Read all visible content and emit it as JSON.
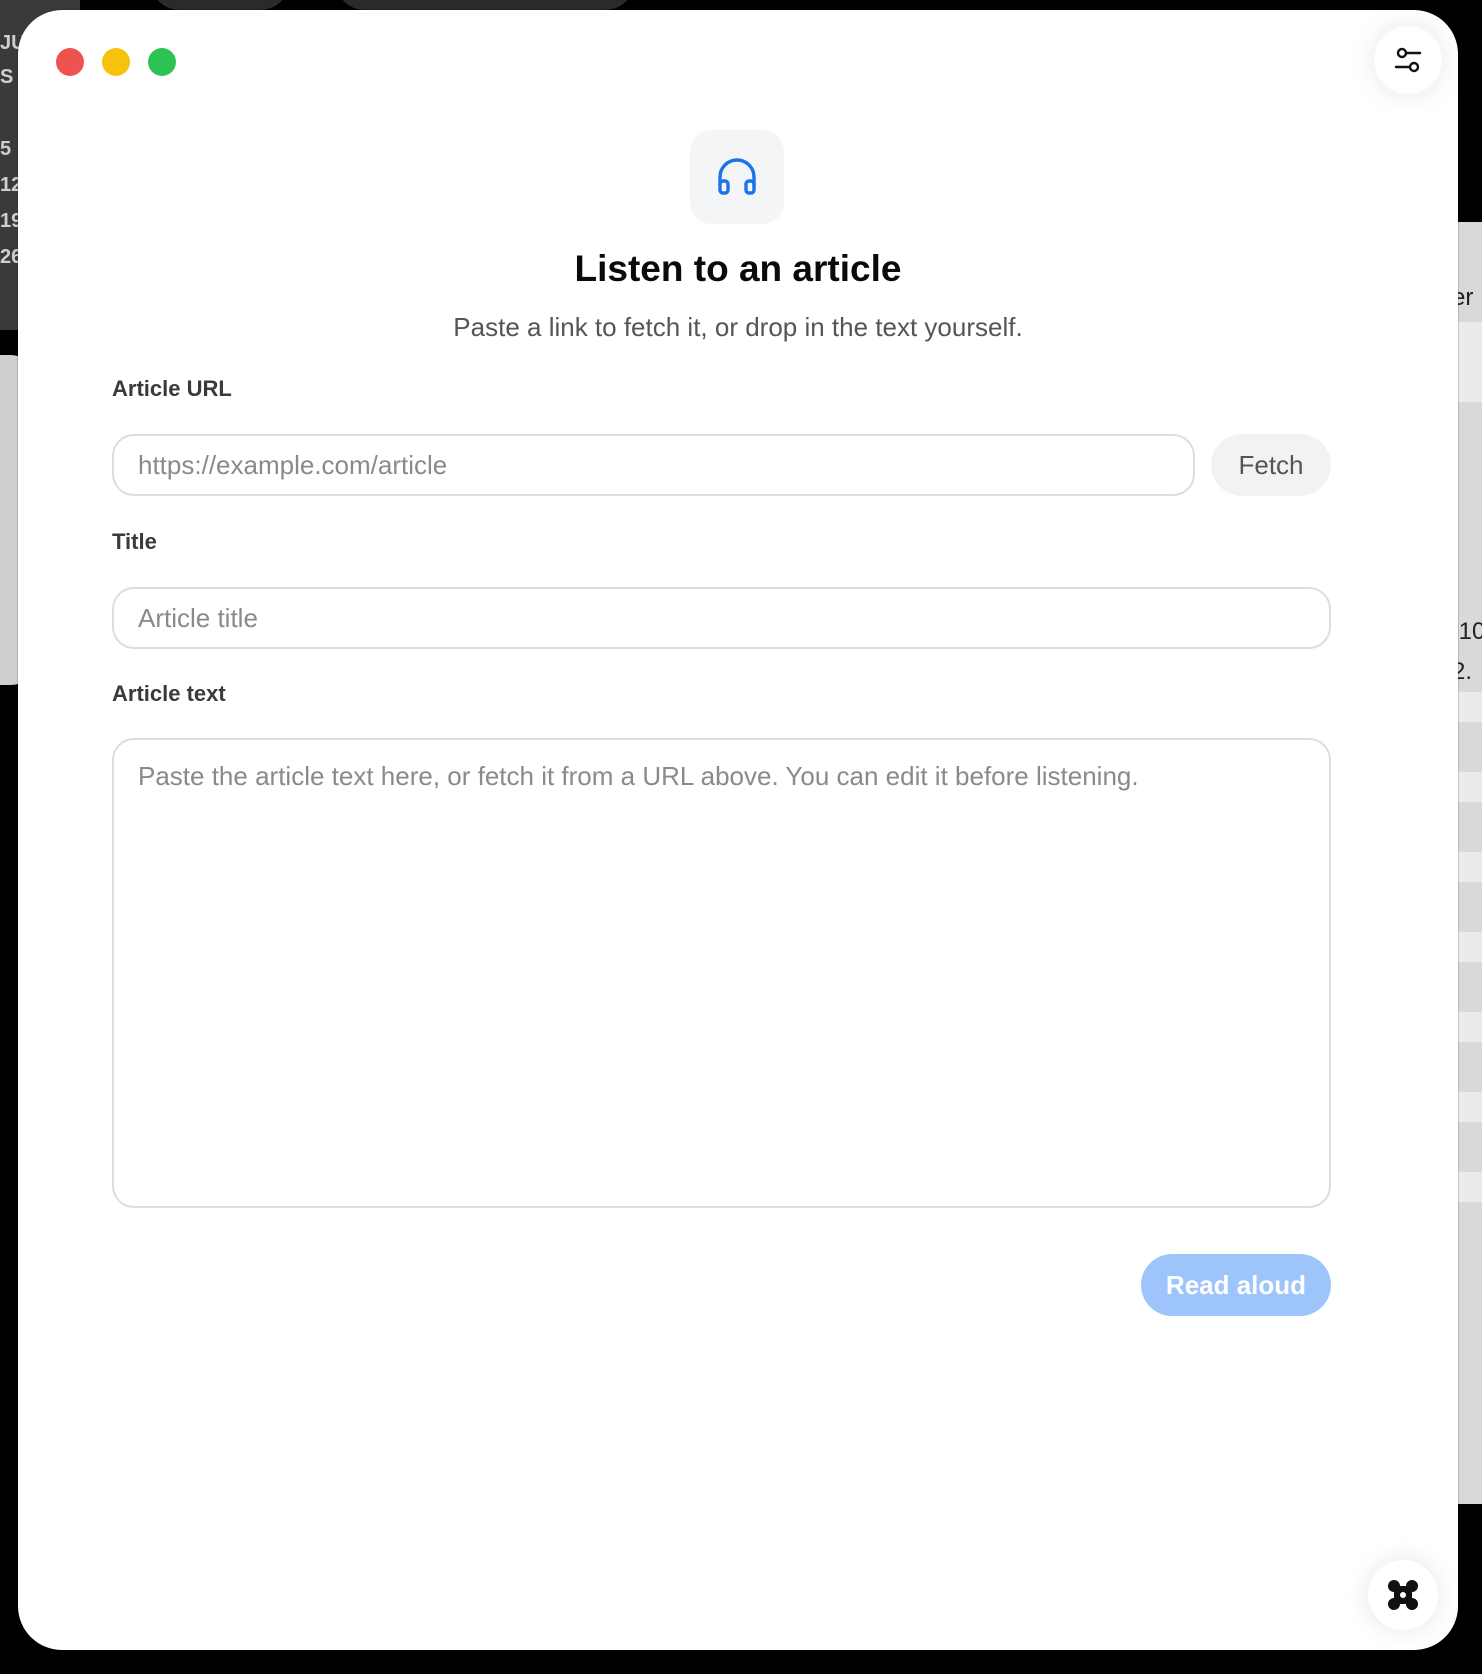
{
  "background": {
    "left_text": [
      "JU",
      "S",
      "5",
      "12",
      "19",
      "26"
    ],
    "right_text": [
      "er",
      ".10",
      "2."
    ]
  },
  "window": {
    "icon": "headphones-icon",
    "title": "Listen to an article",
    "subtitle": "Paste a link to fetch it, or drop in the text yourself.",
    "settings_icon": "sliders-icon",
    "corner_icon": "app-logo-icon"
  },
  "form": {
    "url": {
      "label": "Article URL",
      "placeholder": "https://example.com/article",
      "value": ""
    },
    "fetch_label": "Fetch",
    "title_field": {
      "label": "Title",
      "placeholder": "Article title",
      "value": ""
    },
    "text_field": {
      "label": "Article text",
      "placeholder": "Paste the article text here, or fetch it from a URL above. You can edit it before listening.",
      "value": ""
    },
    "read_aloud_label": "Read aloud"
  },
  "colors": {
    "accent": "#1a73e8",
    "primary_disabled": "#9ec5fb",
    "traffic_red": "#ef5350",
    "traffic_yellow": "#f6c20b",
    "traffic_green": "#2ec254"
  }
}
